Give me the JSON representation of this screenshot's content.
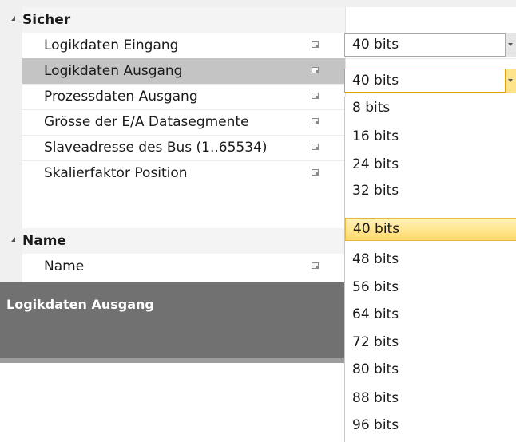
{
  "categories": [
    {
      "label": "Sicher"
    },
    {
      "label": "Name"
    }
  ],
  "properties": [
    {
      "name": "Logikdaten Eingang",
      "value": "40 bits"
    },
    {
      "name": "Logikdaten Ausgang",
      "value": "40 bits"
    },
    {
      "name": "Prozessdaten Ausgang"
    },
    {
      "name": "Grösse der E/A Datasegmente"
    },
    {
      "name": "Slaveadresse des Bus (1..65534)"
    },
    {
      "name": "Skalierfaktor Position"
    },
    {
      "name": "Name"
    }
  ],
  "description": {
    "title": "Logikdaten Ausgang"
  },
  "dropdown": {
    "options": [
      "8 bits",
      "16 bits",
      "24 bits",
      "32 bits",
      "40 bits",
      "48 bits",
      "56 bits",
      "64 bits",
      "72 bits",
      "80 bits",
      "88 bits",
      "96 bits"
    ],
    "selected": "40 bits"
  },
  "colors": {
    "selection": "#c4c4c4",
    "highlight": "#ffd96a",
    "description_bg": "#717171"
  }
}
